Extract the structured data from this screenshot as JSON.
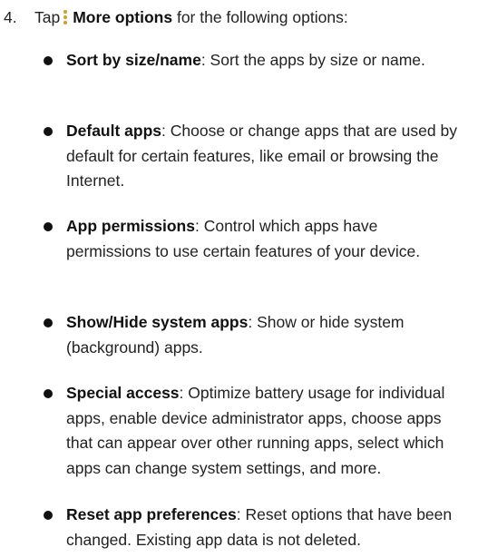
{
  "step": {
    "number": "4.",
    "prefix": "Tap",
    "icon": "more-options-kebab-icon",
    "bold_label": "More options",
    "suffix": "for the following options:"
  },
  "options": [
    {
      "title": "Sort by size/name",
      "description": ": Sort the apps by size or name."
    },
    {
      "title": "Default apps",
      "description": ": Choose or change apps that are used by default for certain features, like email or browsing the Internet."
    },
    {
      "title": "App permissions",
      "description": ": Control which apps have permissions to use certain features of your device."
    },
    {
      "title": "Show/Hide system apps",
      "description": ": Show or hide system (background) apps."
    },
    {
      "title": "Special access",
      "description": ": Optimize battery usage for individual apps, enable device administrator apps, choose apps that can appear over other running apps, select which apps can change system settings, and more."
    },
    {
      "title": "Reset app preferences",
      "description": ": Reset options that have been changed. Existing app data is not deleted."
    }
  ]
}
